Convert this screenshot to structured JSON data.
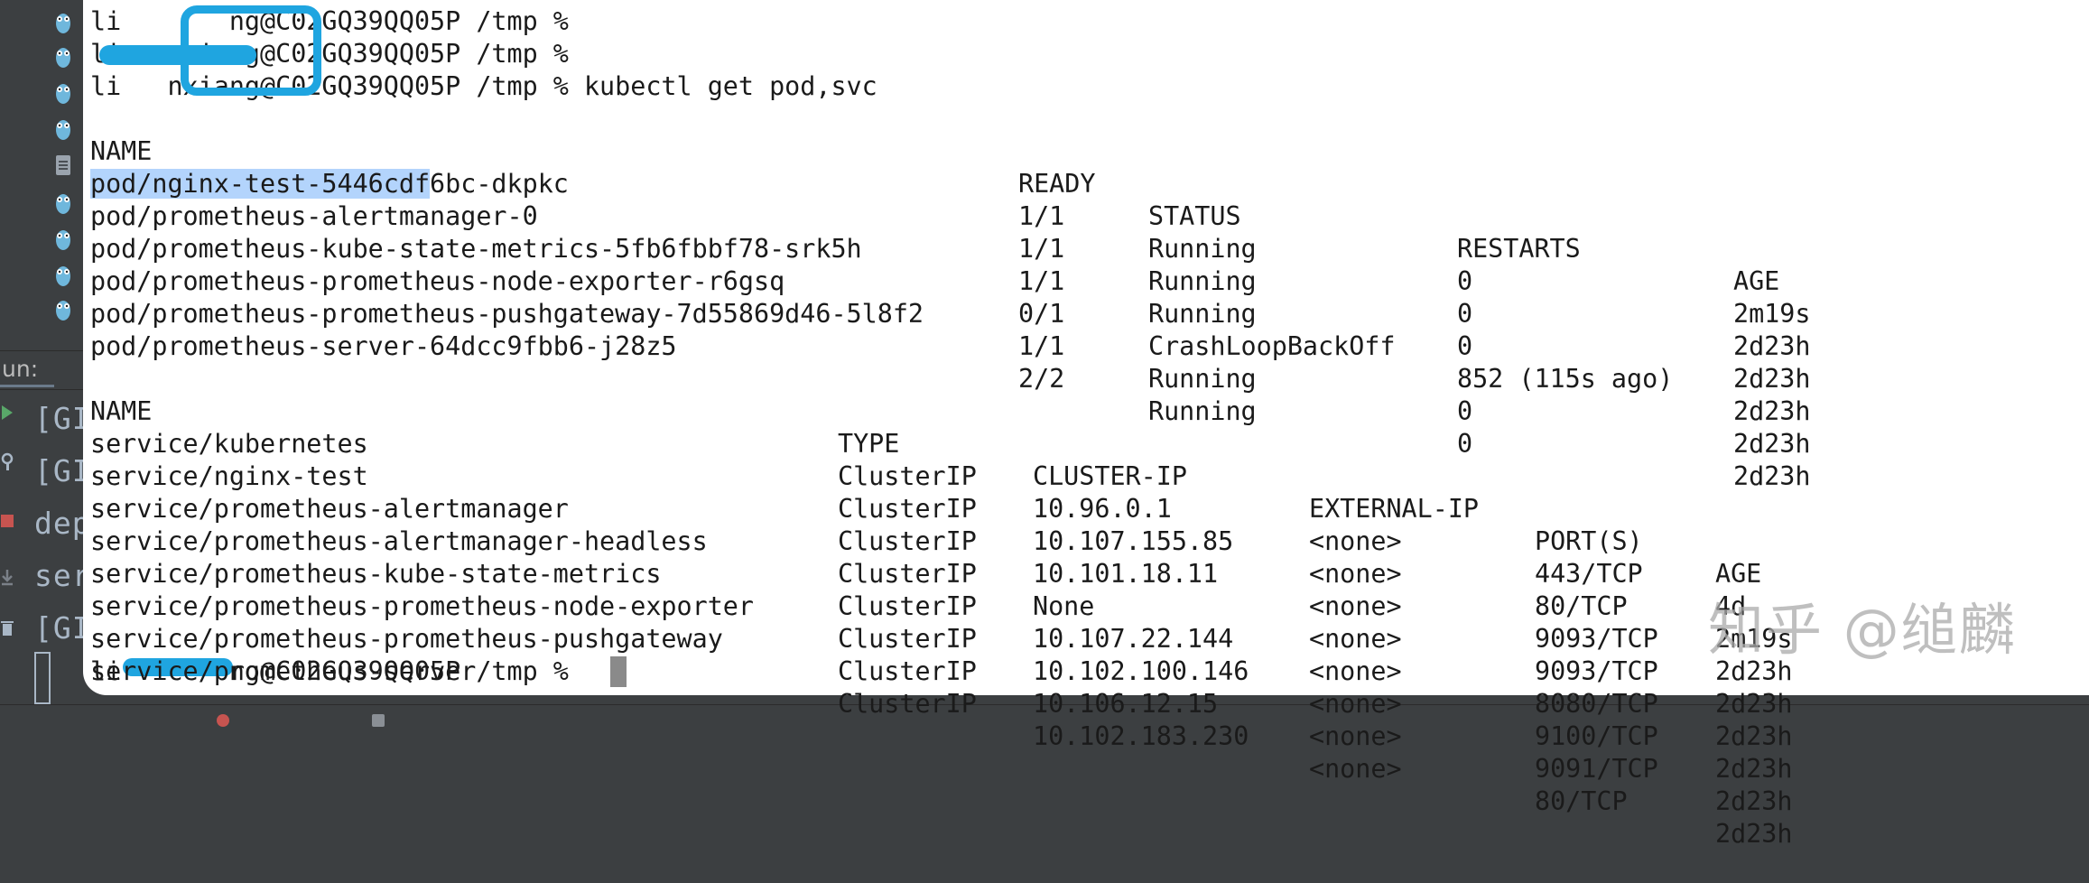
{
  "terminal": {
    "prompt_user_1": "li",
    "prompt_user_2": "ng@C02GQ39QQ05P /tmp % ",
    "prompt_user_2b": "nxiang@C02GQ39QQ05P /tmp % ",
    "prompt_user_3": "li",
    "prompt_user_3b": "nxiang@C02GQ39QQ05P /tmp % kubectl get pod,svc",
    "prompt_final_user": "li",
    "prompt_final_rest": "ng@C02GQ39QQ05P /tmp % ",
    "pods": {
      "headers": [
        "NAME",
        "READY",
        "STATUS",
        "RESTARTS",
        "AGE"
      ],
      "rows": [
        {
          "name_selected": "pod/nginx-test-5446cdf",
          "name_rest": "6bc-dkpkc",
          "ready": "1/1",
          "status": "Running",
          "restarts": "0",
          "age": "2m19s"
        },
        {
          "name": "pod/prometheus-alertmanager-0",
          "ready": "1/1",
          "status": "Running",
          "restarts": "0",
          "age": "2d23h"
        },
        {
          "name": "pod/prometheus-kube-state-metrics-5fb6fbbf78-srk5h",
          "ready": "1/1",
          "status": "Running",
          "restarts": "0",
          "age": "2d23h"
        },
        {
          "name": "pod/prometheus-prometheus-node-exporter-r6gsq",
          "ready": "0/1",
          "status": "CrashLoopBackOff",
          "restarts": "852 (115s ago)",
          "age": "2d23h"
        },
        {
          "name": "pod/prometheus-prometheus-pushgateway-7d55869d46-5l8f2",
          "ready": "1/1",
          "status": "Running",
          "restarts": "0",
          "age": "2d23h"
        },
        {
          "name": "pod/prometheus-server-64dcc9fbb6-j28z5",
          "ready": "2/2",
          "status": "Running",
          "restarts": "0",
          "age": "2d23h"
        }
      ]
    },
    "services": {
      "headers": [
        "NAME",
        "TYPE",
        "CLUSTER-IP",
        "EXTERNAL-IP",
        "PORT(S)",
        "AGE"
      ],
      "rows": [
        {
          "name": "service/kubernetes",
          "type": "ClusterIP",
          "cluster_ip": "10.96.0.1",
          "external_ip": "<none>",
          "ports": "443/TCP",
          "age": "4d"
        },
        {
          "name": "service/nginx-test",
          "type": "ClusterIP",
          "cluster_ip": "10.107.155.85",
          "external_ip": "<none>",
          "ports": "80/TCP",
          "age": "2m19s"
        },
        {
          "name": "service/prometheus-alertmanager",
          "type": "ClusterIP",
          "cluster_ip": "10.101.18.11",
          "external_ip": "<none>",
          "ports": "9093/TCP",
          "age": "2d23h"
        },
        {
          "name": "service/prometheus-alertmanager-headless",
          "type": "ClusterIP",
          "cluster_ip": "None",
          "external_ip": "<none>",
          "ports": "9093/TCP",
          "age": "2d23h"
        },
        {
          "name": "service/prometheus-kube-state-metrics",
          "type": "ClusterIP",
          "cluster_ip": "10.107.22.144",
          "external_ip": "<none>",
          "ports": "8080/TCP",
          "age": "2d23h"
        },
        {
          "name": "service/prometheus-prometheus-node-exporter",
          "type": "ClusterIP",
          "cluster_ip": "10.102.100.146",
          "external_ip": "<none>",
          "ports": "9100/TCP",
          "age": "2d23h"
        },
        {
          "name": "service/prometheus-prometheus-pushgateway",
          "type": "ClusterIP",
          "cluster_ip": "10.106.12.15",
          "external_ip": "<none>",
          "ports": "9091/TCP",
          "age": "2d23h"
        },
        {
          "name": "service/prometheus-server",
          "type": "ClusterIP",
          "cluster_ip": "10.102.183.230",
          "external_ip": "<none>",
          "ports": "80/TCP",
          "age": "2d23h"
        }
      ]
    }
  },
  "ide": {
    "run_label": "un:",
    "run_lines": [
      "[GI",
      "[GI",
      "dep",
      "ser",
      "[GI"
    ]
  },
  "watermark": "知乎 @缒麟",
  "colors": {
    "terminal_bg": "#ffffff",
    "selection": "#b3d4fc",
    "redaction": "#1fa5e0",
    "ide_bg": "#3c3f41"
  },
  "icons": [
    "gopher-icon",
    "file-icon",
    "run-icon",
    "wrench-icon",
    "stop-icon",
    "download-icon",
    "trash-icon"
  ]
}
